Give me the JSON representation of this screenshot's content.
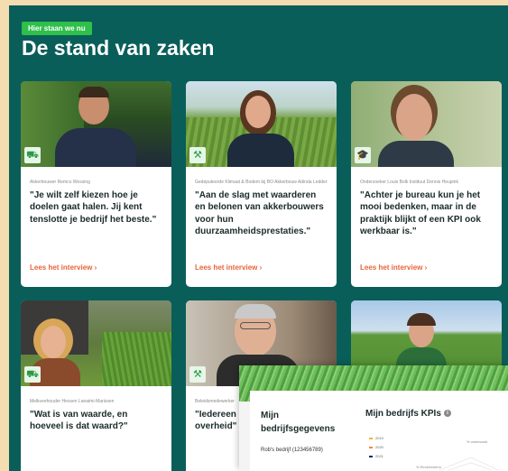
{
  "section": {
    "tag": "Hier staan we nu",
    "title": "De stand van zaken"
  },
  "cards": [
    {
      "icon": "tractor-icon",
      "role": "Akkerbouwer Remco Wessing",
      "quote": "\"Je wilt zelf kiezen hoe je doelen gaat halen. Jij kent tenslotte je bedrijf het beste.\"",
      "link": "Lees het interview ›"
    },
    {
      "icon": "gavel-icon",
      "role": "Gedeputeerde Klimaat & Bodem bij BO Akkerbouw Adinda Ledders",
      "quote": "\"Aan de slag met waarderen en belonen van akkerbouwers voor hun duurzaamheidsprestaties.\"",
      "link": "Lees het interview ›"
    },
    {
      "icon": "graduation-cap-icon",
      "role": "Onderzoeker Louis Bolk Instituut Dennis Heupink",
      "quote": "\"Achter je bureau kun je het mooi bedenken, maar in de praktijk blijkt of een KPI ook werkbaar is.\"",
      "link": "Lees het interview ›"
    },
    {
      "icon": "tractor-icon",
      "role": "Melkveehouder Hessen Lanaimi-Marissen",
      "quote": "\"Wat is van waarde, en hoeveel is dat waard?\"",
      "link": ""
    },
    {
      "icon": "gavel-icon",
      "role": "Beleidsmedewerker",
      "quote": "\"Iedereen ... dezelfde ... overheid\"",
      "link": ""
    },
    {
      "icon": "",
      "role": "",
      "quote": "",
      "link": ""
    }
  ],
  "overlay": {
    "left_title": "Mijn bedrijfsgegevens",
    "company": "Rob's bedrijf (123456789)",
    "right_title": "Mijn bedrijfs KPIs",
    "years": [
      "2019",
      "2020",
      "2021"
    ],
    "chart_labels": [
      "% onderzoek",
      "% Eindverwerm"
    ]
  },
  "colors": {
    "panel": "#0a5e59",
    "accent": "#2fbf4b",
    "link": "#e7643a",
    "outer": "#f3ddb1"
  }
}
